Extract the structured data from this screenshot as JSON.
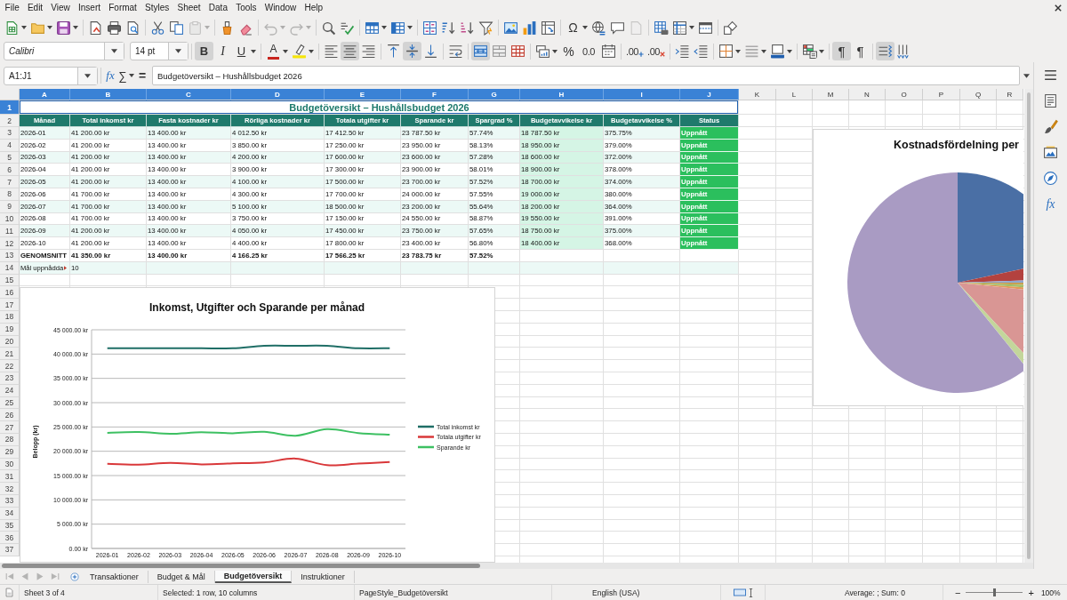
{
  "menu_bar": [
    "File",
    "Edit",
    "View",
    "Insert",
    "Format",
    "Styles",
    "Sheet",
    "Data",
    "Tools",
    "Window",
    "Help"
  ],
  "standard_toolbar": [
    [
      {
        "kind": "new",
        "menu": true,
        "disabled": false
      },
      {
        "kind": "open",
        "menu": true,
        "disabled": false
      },
      {
        "kind": "save",
        "menu": true,
        "disabled": false
      }
    ],
    [
      {
        "kind": "export-pdf",
        "menu": false,
        "disabled": false
      },
      {
        "kind": "print",
        "menu": false,
        "disabled": false
      },
      {
        "kind": "print-preview",
        "menu": false,
        "disabled": false
      }
    ],
    [
      {
        "kind": "cut",
        "menu": false,
        "disabled": false
      },
      {
        "kind": "copy",
        "menu": false,
        "disabled": false
      },
      {
        "kind": "paste",
        "menu": true,
        "disabled": true
      }
    ],
    [
      {
        "kind": "clone-format",
        "menu": false,
        "disabled": false
      },
      {
        "kind": "clear-format",
        "menu": false,
        "disabled": false
      }
    ],
    [
      {
        "kind": "undo",
        "menu": true,
        "disabled": true
      },
      {
        "kind": "redo",
        "menu": true,
        "disabled": true
      }
    ],
    [
      {
        "kind": "find-replace",
        "menu": false,
        "disabled": false
      },
      {
        "kind": "spelling",
        "menu": false,
        "disabled": false
      }
    ],
    [
      {
        "kind": "rows",
        "menu": true,
        "disabled": false
      },
      {
        "kind": "columns",
        "menu": true,
        "disabled": false
      }
    ],
    [
      {
        "kind": "sort",
        "menu": false,
        "disabled": false
      },
      {
        "kind": "sort-ascending",
        "menu": false,
        "disabled": false
      },
      {
        "kind": "sort-descending",
        "menu": false,
        "disabled": false
      },
      {
        "kind": "autofilter",
        "menu": false,
        "disabled": false
      }
    ],
    [
      {
        "kind": "image",
        "menu": false,
        "disabled": false
      },
      {
        "kind": "chart",
        "menu": false,
        "disabled": false
      },
      {
        "kind": "pivot-table",
        "menu": false,
        "disabled": false
      }
    ],
    [
      {
        "kind": "special-character",
        "label": "Ω",
        "menu": true,
        "disabled": false
      },
      {
        "kind": "hyperlink",
        "menu": false,
        "disabled": false
      },
      {
        "kind": "comment",
        "menu": false,
        "disabled": false
      },
      {
        "kind": "headers-footers",
        "menu": false,
        "disabled": true
      }
    ],
    [
      {
        "kind": "print-area",
        "menu": false,
        "disabled": false
      },
      {
        "kind": "freeze",
        "menu": true,
        "disabled": false
      },
      {
        "kind": "split",
        "menu": false,
        "disabled": false
      }
    ],
    [
      {
        "kind": "draw",
        "menu": false,
        "disabled": false
      }
    ]
  ],
  "formatting_toolbar": {
    "font_name": "Calibri",
    "font_size": "14 pt",
    "groups": [
      [
        {
          "kind": "bold",
          "label": "B",
          "on": true,
          "menu": false
        },
        {
          "kind": "italic",
          "label": "I",
          "on": false,
          "menu": false
        },
        {
          "kind": "underline",
          "label": "U",
          "on": false,
          "menu": true
        }
      ],
      [
        {
          "kind": "font-color",
          "label": "A",
          "on": false,
          "menu": true
        },
        {
          "kind": "highlight",
          "on": false,
          "menu": true
        }
      ],
      [
        {
          "kind": "align-left",
          "on": false,
          "menu": false
        },
        {
          "kind": "align-center",
          "on": true,
          "menu": false
        },
        {
          "kind": "align-right",
          "on": false,
          "menu": false
        }
      ],
      [
        {
          "kind": "align-top",
          "on": false,
          "menu": false
        },
        {
          "kind": "align-middle",
          "on": true,
          "menu": false
        },
        {
          "kind": "align-bottom",
          "on": false,
          "menu": false
        }
      ],
      [
        {
          "kind": "wrap",
          "on": false,
          "menu": false
        }
      ],
      [
        {
          "kind": "merge-center",
          "on": true,
          "menu": false
        },
        {
          "kind": "merge",
          "on": false,
          "menu": false
        },
        {
          "kind": "unmerge",
          "on": false,
          "menu": false
        }
      ],
      [
        {
          "kind": "currency",
          "on": false,
          "menu": true
        },
        {
          "kind": "percent",
          "label": "%",
          "on": false,
          "menu": false
        },
        {
          "kind": "number",
          "label": "0.0",
          "on": false,
          "menu": false
        },
        {
          "kind": "date",
          "on": false,
          "menu": false
        }
      ],
      [
        {
          "kind": "add-decimal",
          "label": ".00",
          "on": false,
          "menu": false
        },
        {
          "kind": "delete-decimal",
          "label": ".00",
          "on": false,
          "menu": false
        }
      ],
      [
        {
          "kind": "indent",
          "on": false,
          "menu": false
        },
        {
          "kind": "outdent",
          "on": false,
          "menu": false
        }
      ],
      [
        {
          "kind": "borders",
          "on": false,
          "menu": true
        },
        {
          "kind": "border-style",
          "on": false,
          "menu": true
        },
        {
          "kind": "border-color",
          "on": false,
          "menu": true
        }
      ],
      [
        {
          "kind": "conditional",
          "on": false,
          "menu": true
        }
      ],
      [
        {
          "kind": "ltr",
          "label": "¶",
          "on": true,
          "menu": false
        },
        {
          "kind": "rtl",
          "label": "¶",
          "on": false,
          "menu": false
        }
      ],
      [
        {
          "kind": "text-ltr",
          "on": true,
          "menu": false
        },
        {
          "kind": "text-ttb",
          "on": false,
          "menu": false
        }
      ]
    ]
  },
  "formula_bar": {
    "name_box": "A1:J1",
    "buttons": [
      {
        "kind": "function-wizard",
        "label": "fx",
        "menu": false
      },
      {
        "kind": "sum",
        "label": "∑",
        "menu": true
      },
      {
        "kind": "formula",
        "label": "=",
        "menu": false
      }
    ],
    "content": "Budgetöversikt – Hushållsbudget 2026"
  },
  "sidebar": [
    {
      "kind": "menu"
    },
    {
      "kind": "properties"
    },
    {
      "kind": "styles"
    },
    {
      "kind": "gallery"
    },
    {
      "kind": "navigator"
    },
    {
      "kind": "functions",
      "label": "fx"
    }
  ],
  "sheet": {
    "columns": [
      {
        "label": "A",
        "selected": true
      },
      {
        "label": "B",
        "selected": true
      },
      {
        "label": "C",
        "selected": true
      },
      {
        "label": "D",
        "selected": true
      },
      {
        "label": "E",
        "selected": true
      },
      {
        "label": "F",
        "selected": true
      },
      {
        "label": "G",
        "selected": true
      },
      {
        "label": "H",
        "selected": true
      },
      {
        "label": "I",
        "selected": true
      },
      {
        "label": "J",
        "selected": true
      },
      {
        "label": "K",
        "selected": false
      },
      {
        "label": "L",
        "selected": false
      },
      {
        "label": "M",
        "selected": false
      },
      {
        "label": "N",
        "selected": false
      },
      {
        "label": "O",
        "selected": false
      },
      {
        "label": "P",
        "selected": false
      },
      {
        "label": "Q",
        "selected": false
      },
      {
        "label": "R",
        "selected": false
      }
    ],
    "rows": [
      {
        "label": "1",
        "selected": true
      },
      {
        "label": "2",
        "selected": false
      },
      {
        "label": "3",
        "selected": false
      },
      {
        "label": "4",
        "selected": false
      },
      {
        "label": "5",
        "selected": false
      },
      {
        "label": "6",
        "selected": false
      },
      {
        "label": "7",
        "selected": false
      },
      {
        "label": "8",
        "selected": false
      },
      {
        "label": "9",
        "selected": false
      },
      {
        "label": "10",
        "selected": false
      },
      {
        "label": "11",
        "selected": false
      },
      {
        "label": "12",
        "selected": false
      },
      {
        "label": "13",
        "selected": false
      },
      {
        "label": "14",
        "selected": false
      },
      {
        "label": "15",
        "selected": false
      },
      {
        "label": "16",
        "selected": false
      },
      {
        "label": "17",
        "selected": false
      },
      {
        "label": "18",
        "selected": false
      },
      {
        "label": "19",
        "selected": false
      },
      {
        "label": "20",
        "selected": false
      },
      {
        "label": "21",
        "selected": false
      },
      {
        "label": "22",
        "selected": false
      },
      {
        "label": "23",
        "selected": false
      },
      {
        "label": "24",
        "selected": false
      },
      {
        "label": "25",
        "selected": false
      },
      {
        "label": "26",
        "selected": false
      },
      {
        "label": "27",
        "selected": false
      },
      {
        "label": "28",
        "selected": false
      },
      {
        "label": "29",
        "selected": false
      },
      {
        "label": "30",
        "selected": false
      },
      {
        "label": "31",
        "selected": false
      },
      {
        "label": "32",
        "selected": false
      },
      {
        "label": "33",
        "selected": false
      },
      {
        "label": "34",
        "selected": false
      },
      {
        "label": "35",
        "selected": false
      },
      {
        "label": "36",
        "selected": false
      },
      {
        "label": "37",
        "selected": false
      }
    ],
    "title": {
      "text": "Budgetöversikt – Hushållsbudget 2026",
      "selected": true
    },
    "header": [
      "Månad",
      "Total inkomst kr",
      "Fasta kostnader kr",
      "Rörliga kostnader kr",
      "Totala utgifter kr",
      "Sparande kr",
      "Spargrad %",
      "Budgetavvikelse kr",
      "Budgetavvikelse %",
      "Status"
    ],
    "data_rows": [
      [
        "2026-01",
        "41 200.00 kr",
        "13 400.00 kr",
        "4 012.50 kr",
        "17 412.50 kr",
        "23 787.50 kr",
        "57.74%",
        "18 787.50 kr",
        "375.75%",
        "Uppnått"
      ],
      [
        "2026-02",
        "41 200.00 kr",
        "13 400.00 kr",
        "3 850.00 kr",
        "17 250.00 kr",
        "23 950.00 kr",
        "58.13%",
        "18 950.00 kr",
        "379.00%",
        "Uppnått"
      ],
      [
        "2026-03",
        "41 200.00 kr",
        "13 400.00 kr",
        "4 200.00 kr",
        "17 600.00 kr",
        "23 600.00 kr",
        "57.28%",
        "18 600.00 kr",
        "372.00%",
        "Uppnått"
      ],
      [
        "2026-04",
        "41 200.00 kr",
        "13 400.00 kr",
        "3 900.00 kr",
        "17 300.00 kr",
        "23 900.00 kr",
        "58.01%",
        "18 900.00 kr",
        "378.00%",
        "Uppnått"
      ],
      [
        "2026-05",
        "41 200.00 kr",
        "13 400.00 kr",
        "4 100.00 kr",
        "17 500.00 kr",
        "23 700.00 kr",
        "57.52%",
        "18 700.00 kr",
        "374.00%",
        "Uppnått"
      ],
      [
        "2026-06",
        "41 700.00 kr",
        "13 400.00 kr",
        "4 300.00 kr",
        "17 700.00 kr",
        "24 000.00 kr",
        "57.55%",
        "19 000.00 kr",
        "380.00%",
        "Uppnått"
      ],
      [
        "2026-07",
        "41 700.00 kr",
        "13 400.00 kr",
        "5 100.00 kr",
        "18 500.00 kr",
        "23 200.00 kr",
        "55.64%",
        "18 200.00 kr",
        "364.00%",
        "Uppnått"
      ],
      [
        "2026-08",
        "41 700.00 kr",
        "13 400.00 kr",
        "3 750.00 kr",
        "17 150.00 kr",
        "24 550.00 kr",
        "58.87%",
        "19 550.00 kr",
        "391.00%",
        "Uppnått"
      ],
      [
        "2026-09",
        "41 200.00 kr",
        "13 400.00 kr",
        "4 050.00 kr",
        "17 450.00 kr",
        "23 750.00 kr",
        "57.65%",
        "18 750.00 kr",
        "375.00%",
        "Uppnått"
      ],
      [
        "2026-10",
        "41 200.00 kr",
        "13 400.00 kr",
        "4 400.00 kr",
        "17 800.00 kr",
        "23 400.00 kr",
        "56.80%",
        "18 400.00 kr",
        "368.00%",
        "Uppnått"
      ]
    ],
    "average_row": [
      "GENOMSNITT",
      "41 350.00 kr",
      "13 400.00 kr",
      "4 166.25 kr",
      "17 566.25 kr",
      "23 783.75 kr",
      "57.52%"
    ],
    "goal_row": {
      "label": "Mål uppnådda",
      "clipped": true,
      "value": "10"
    }
  },
  "line_chart": {
    "chart_data": {
      "type": "line",
      "title": "Inkomst, Utgifter och Sparande per månad",
      "ylabel": "Belopp (kr)",
      "categories": [
        "2026-01",
        "2026-02",
        "2026-03",
        "2026-04",
        "2026-05",
        "2026-06",
        "2026-07",
        "2026-08",
        "2026-09",
        "2026-10"
      ],
      "series": [
        {
          "name": "Total inkomst kr",
          "color": "#1f6e66",
          "values": [
            41200,
            41200,
            41200,
            41200,
            41200,
            41700,
            41700,
            41700,
            41200,
            41200
          ]
        },
        {
          "name": "Totala utgifter kr",
          "color": "#d9383a",
          "values": [
            17412.5,
            17250,
            17600,
            17300,
            17500,
            17700,
            18500,
            17150,
            17450,
            17800
          ]
        },
        {
          "name": "Sparande kr",
          "color": "#3dc062",
          "values": [
            23787.5,
            23950,
            23600,
            23900,
            23700,
            24000,
            23200,
            24550,
            23750,
            23400
          ]
        }
      ],
      "ylim": [
        0,
        45000
      ],
      "yticks": [
        {
          "value": 0,
          "label": "0.00 kr"
        },
        {
          "value": 5000,
          "label": "5 000.00 kr"
        },
        {
          "value": 10000,
          "label": "10 000.00 kr"
        },
        {
          "value": 15000,
          "label": "15 000.00 kr"
        },
        {
          "value": 20000,
          "label": "20 000.00 kr"
        },
        {
          "value": 25000,
          "label": "25 000.00 kr"
        },
        {
          "value": 30000,
          "label": "30 000.00 kr"
        },
        {
          "value": 35000,
          "label": "35 000.00 kr"
        },
        {
          "value": 40000,
          "label": "40 000.00 kr"
        },
        {
          "value": 45000,
          "label": "45 000.00 kr"
        }
      ],
      "grid": true,
      "legend": "right"
    }
  },
  "pie_chart": {
    "title": "Kostnadsfördelning per"
  },
  "sheet_navigation": [
    {
      "kind": "first",
      "disabled": true
    },
    {
      "kind": "previous",
      "disabled": true
    },
    {
      "kind": "next",
      "disabled": true
    },
    {
      "kind": "last",
      "disabled": true
    }
  ],
  "sheet_tabs": [
    {
      "label": "Transaktioner",
      "selected": false
    },
    {
      "label": "Budget & Mål",
      "selected": false
    },
    {
      "label": "Budgetöversikt",
      "selected": true
    },
    {
      "label": "Instruktioner",
      "selected": false
    }
  ],
  "status_bar": {
    "sheet": "Sheet 3 of 4",
    "selection": "Selected: 1 row, 10 columns",
    "page_style": "PageStyle_Budgetöversikt",
    "language": "English (USA)",
    "summary": "Average: ; Sum: 0",
    "zoom": {
      "minus": "−",
      "plus": "+",
      "level": 0.5,
      "value": "100%"
    }
  }
}
